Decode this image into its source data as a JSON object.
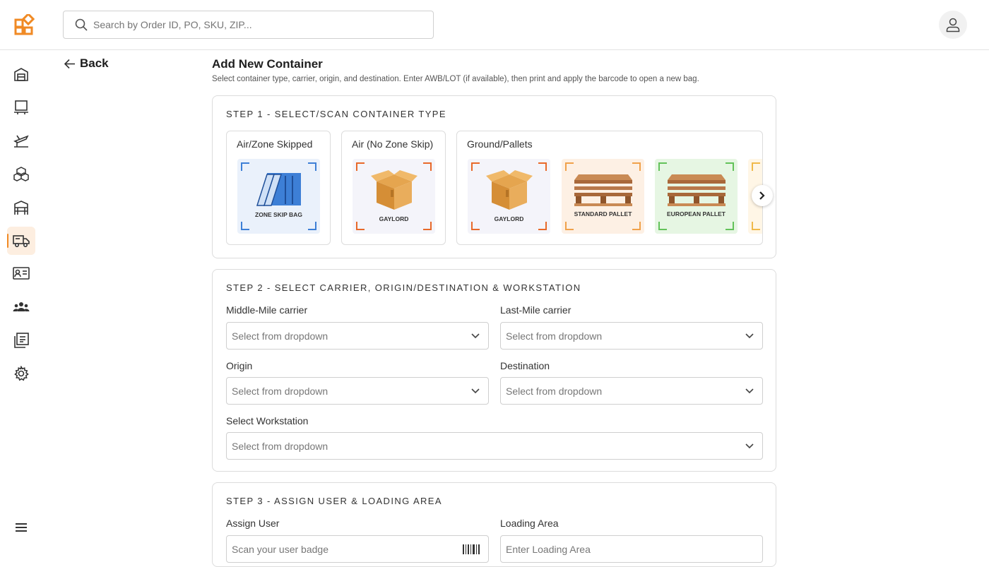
{
  "search": {
    "placeholder": "Search by Order ID, PO, SKU, ZIP..."
  },
  "back_label": "Back",
  "page": {
    "title": "Add New Container",
    "subtitle": "Select container type, carrier, origin, and destination. Enter AWB/LOT (if available), then print and apply the barcode to open a new bag."
  },
  "sidebar": {
    "items": [
      {
        "icon": "warehouse-icon"
      },
      {
        "icon": "workstation-icon"
      },
      {
        "icon": "flight-icon"
      },
      {
        "icon": "boxes-icon"
      },
      {
        "icon": "storage-rack-icon"
      },
      {
        "icon": "truck-icon",
        "active": true
      },
      {
        "icon": "contact-card-icon"
      },
      {
        "icon": "team-icon"
      },
      {
        "icon": "reports-icon"
      },
      {
        "icon": "settings-icon"
      }
    ],
    "menu_icon": "menu-icon"
  },
  "step1": {
    "title": "STEP 1 - SELECT/SCAN CONTAINER TYPE",
    "groups": [
      {
        "label": "Air/Zone Skipped",
        "tiles": [
          {
            "caption": "ZONE SKIP BAG",
            "color": "#3d7fd6"
          }
        ]
      },
      {
        "label": "Air (No Zone Skip)",
        "tiles": [
          {
            "caption": "GAYLORD",
            "color": "#e8692a"
          }
        ]
      },
      {
        "label": "Ground/Pallets",
        "tiles": [
          {
            "caption": "GAYLORD",
            "color": "#e8692a"
          },
          {
            "caption": "STANDARD PALLET",
            "color": "#f0a14a"
          },
          {
            "caption": "EUROPEAN PALLET",
            "color": "#63c25a"
          }
        ]
      }
    ]
  },
  "step2": {
    "title": "STEP 2 - SELECT CARRIER, ORIGIN/DESTINATION & WORKSTATION",
    "middle_mile": {
      "label": "Middle-Mile carrier",
      "value": "Select from dropdown"
    },
    "last_mile": {
      "label": "Last-Mile carrier",
      "value": "Select from dropdown"
    },
    "origin": {
      "label": "Origin",
      "value": "Select from dropdown"
    },
    "destination": {
      "label": "Destination",
      "value": "Select from dropdown"
    },
    "workstation": {
      "label": "Select Workstation",
      "value": "Select from dropdown"
    }
  },
  "step3": {
    "title": "STEP 3 - ASSIGN USER & LOADING AREA",
    "assign_user": {
      "label": "Assign User",
      "placeholder": "Scan your user badge"
    },
    "loading_area": {
      "label": "Loading Area",
      "placeholder": "Enter Loading Area"
    }
  },
  "colors": {
    "accent": "#f08a24",
    "active_bg": "#fdeee0"
  }
}
